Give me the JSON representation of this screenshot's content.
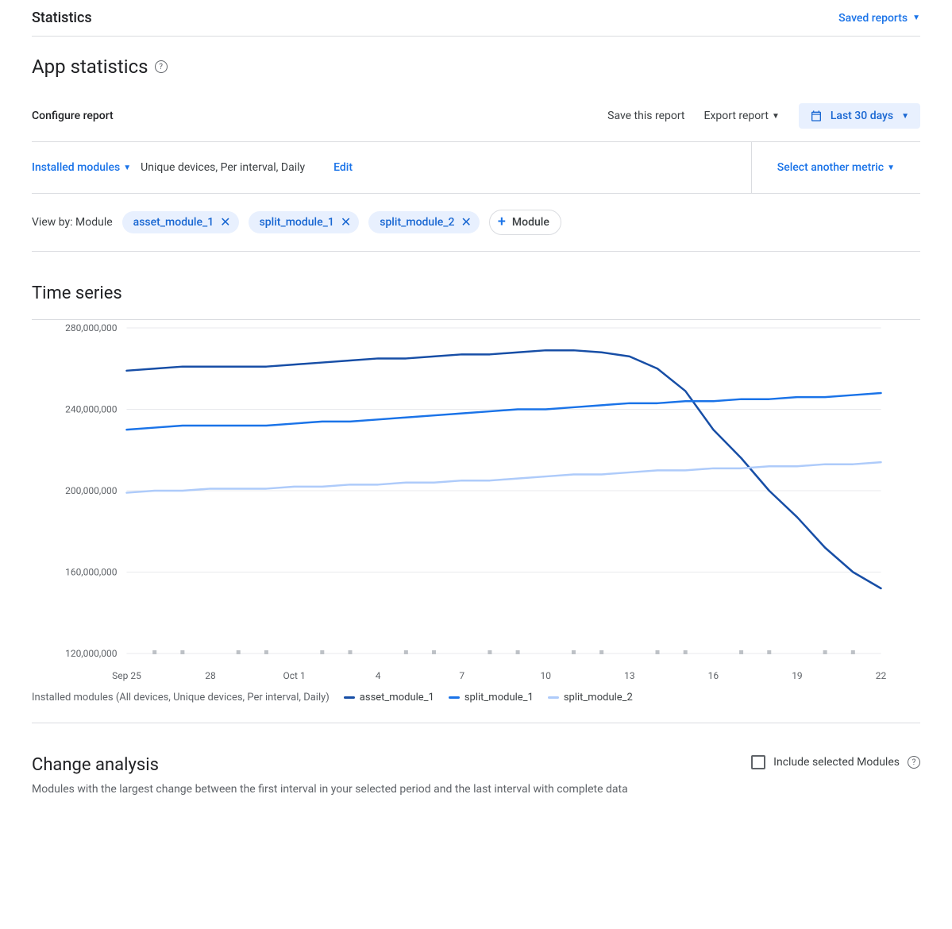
{
  "header": {
    "statistics_label": "Statistics",
    "saved_reports_label": "Saved reports"
  },
  "page": {
    "title": "App statistics"
  },
  "configure": {
    "label": "Configure report",
    "save_report": "Save this report",
    "export_report": "Export report",
    "date_range": "Last 30 days"
  },
  "metrics": {
    "primary": "Installed modules",
    "secondary": "Unique devices, Per interval, Daily",
    "edit": "Edit",
    "select_another": "Select another metric"
  },
  "viewby": {
    "label": "View by: Module",
    "chips": [
      "asset_module_1",
      "split_module_1",
      "split_module_2"
    ],
    "add_label": "Module"
  },
  "timeseries": {
    "title": "Time series",
    "legend_prefix": "Installed modules (All devices, Unique devices, Per interval, Daily)"
  },
  "change": {
    "title": "Change analysis",
    "desc": "Modules with the largest change between the first interval in your selected period and the last interval with complete data",
    "include_label": "Include selected Modules"
  },
  "colors": {
    "series1": "#174ea6",
    "series2": "#1a73e8",
    "series3": "#aecbfa"
  },
  "chart_data": {
    "type": "line",
    "title": "Time series",
    "ylabel": "",
    "ylim": [
      120000000,
      280000000
    ],
    "yticks": [
      "280,000,000",
      "240,000,000",
      "200,000,000",
      "160,000,000",
      "120,000,000"
    ],
    "xticks": [
      "Sep 25",
      "28",
      "Oct 1",
      "4",
      "7",
      "10",
      "13",
      "16",
      "19",
      "22"
    ],
    "x": [
      "Sep 25",
      "Sep 26",
      "Sep 27",
      "Sep 28",
      "Sep 29",
      "Sep 30",
      "Oct 1",
      "Oct 2",
      "Oct 3",
      "Oct 4",
      "Oct 5",
      "Oct 6",
      "Oct 7",
      "Oct 8",
      "Oct 9",
      "Oct 10",
      "Oct 11",
      "Oct 12",
      "Oct 13",
      "Oct 14",
      "Oct 15",
      "Oct 16",
      "Oct 17",
      "Oct 18",
      "Oct 19",
      "Oct 20",
      "Oct 21",
      "Oct 22"
    ],
    "series": [
      {
        "name": "asset_module_1",
        "color": "#174ea6",
        "values": [
          259000000,
          260000000,
          261000000,
          261000000,
          261000000,
          261000000,
          262000000,
          263000000,
          264000000,
          265000000,
          265000000,
          266000000,
          267000000,
          267000000,
          268000000,
          269000000,
          269000000,
          268000000,
          266000000,
          260000000,
          249000000,
          230000000,
          216000000,
          200000000,
          187000000,
          172000000,
          160000000,
          152000000
        ]
      },
      {
        "name": "split_module_1",
        "color": "#1a73e8",
        "values": [
          230000000,
          231000000,
          232000000,
          232000000,
          232000000,
          232000000,
          233000000,
          234000000,
          234000000,
          235000000,
          236000000,
          237000000,
          238000000,
          239000000,
          240000000,
          240000000,
          241000000,
          242000000,
          243000000,
          243000000,
          244000000,
          244000000,
          245000000,
          245000000,
          246000000,
          246000000,
          247000000,
          248000000
        ]
      },
      {
        "name": "split_module_2",
        "color": "#aecbfa",
        "values": [
          199000000,
          200000000,
          200000000,
          201000000,
          201000000,
          201000000,
          202000000,
          202000000,
          203000000,
          203000000,
          204000000,
          204000000,
          205000000,
          205000000,
          206000000,
          207000000,
          208000000,
          208000000,
          209000000,
          210000000,
          210000000,
          211000000,
          211000000,
          212000000,
          212000000,
          213000000,
          213000000,
          214000000
        ]
      }
    ]
  }
}
